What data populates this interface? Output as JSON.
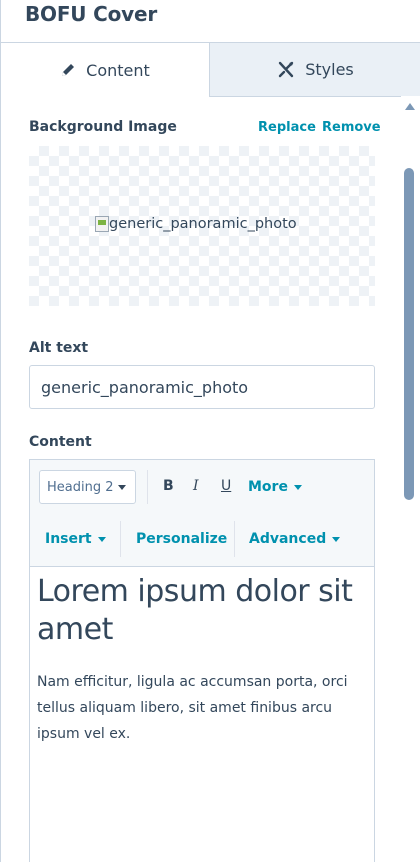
{
  "header": {
    "title": "BOFU Cover"
  },
  "tabs": [
    {
      "label": "Content",
      "icon": "pencil-icon",
      "active": true
    },
    {
      "label": "Styles",
      "icon": "scissors-icon",
      "active": false
    }
  ],
  "background_image": {
    "label": "Background Image",
    "replace_label": "Replace",
    "remove_label": "Remove",
    "broken_alt": "generic_panoramic_photo"
  },
  "alt_text": {
    "label": "Alt text",
    "value": "generic_panoramic_photo"
  },
  "content": {
    "label": "Content",
    "toolbar": {
      "heading_select": "Heading 2",
      "bold": "B",
      "italic": "I",
      "underline": "U",
      "more": "More",
      "insert": "Insert",
      "personalize": "Personalize",
      "advanced": "Advanced"
    },
    "heading": "Lorem ipsum dolor sit amet",
    "paragraph": "Nam efficitur, ligula ac accumsan porta, orci tellus aliquam libero, sit amet finibus arcu ipsum vel ex."
  },
  "colors": {
    "link": "#0091ae",
    "text": "#33475b",
    "border": "#cbd6e2",
    "toolbar_bg": "#f5f8fa",
    "inactive_tab_bg": "#eaf0f6",
    "scroll_thumb": "#7c98b6"
  }
}
